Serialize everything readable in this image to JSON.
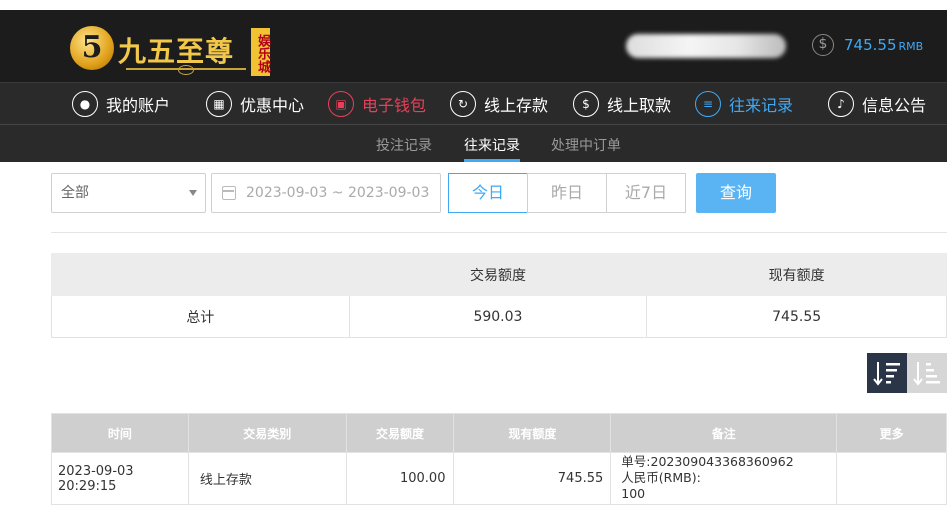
{
  "header": {
    "logo_mark": "5",
    "logo_text": "九五至尊",
    "logo_tag": "娱乐城",
    "balance_icon": "yuan-coin-icon",
    "balance_value": "745.55",
    "balance_unit": "RMB"
  },
  "nav": {
    "items": [
      {
        "label": "我的账户",
        "icon": "user-icon"
      },
      {
        "label": "优惠中心",
        "icon": "gift-icon"
      },
      {
        "label": "电子钱包",
        "icon": "wallet-icon"
      },
      {
        "label": "线上存款",
        "icon": "deposit-icon"
      },
      {
        "label": "线上取款",
        "icon": "withdraw-icon"
      },
      {
        "label": "往来记录",
        "icon": "records-icon"
      },
      {
        "label": "信息公告",
        "icon": "bell-icon"
      }
    ]
  },
  "subnav": {
    "items": [
      "投注记录",
      "往来记录",
      "处理中订单"
    ],
    "active": "往来记录"
  },
  "filters": {
    "type_select": "全部",
    "date_range": "2023-09-03 ~ 2023-09-03",
    "quick": [
      "今日",
      "昨日",
      "近7日"
    ],
    "active_quick": "今日",
    "query_label": "查询"
  },
  "summary": {
    "headers": [
      "",
      "交易额度",
      "现有额度"
    ],
    "row": [
      "总计",
      "590.03",
      "745.55"
    ]
  },
  "records": {
    "headers": [
      "时间",
      "交易类别",
      "交易额度",
      "现有额度",
      "备注",
      "更多"
    ],
    "rows": [
      {
        "time": "2023-09-03 20:29:15",
        "type": "线上存款",
        "amount": "100.00",
        "balance": "745.55",
        "note_line1": "单号:202309043368360962",
        "note_line2": "人民币(RMB):",
        "note_line3": "100",
        "more": ""
      }
    ]
  }
}
